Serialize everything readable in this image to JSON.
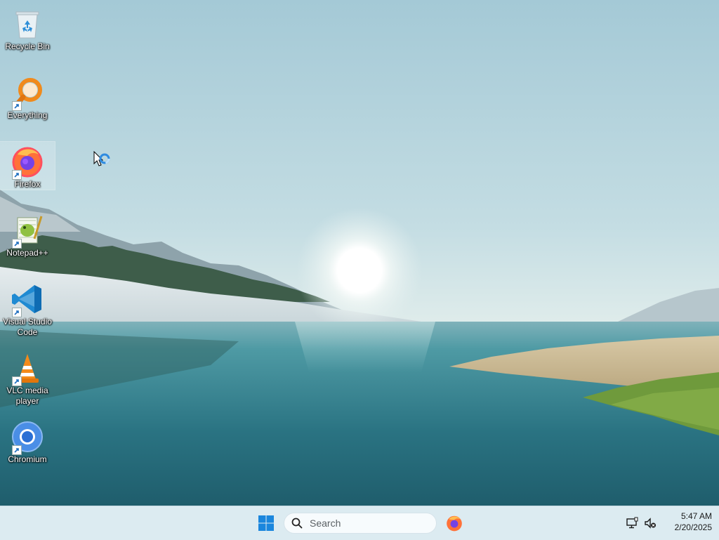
{
  "desktop": {
    "icons": [
      {
        "label": "Recycle Bin"
      },
      {
        "label": "Everything"
      },
      {
        "label": "Firefox"
      },
      {
        "label": "Notepad++"
      },
      {
        "label": "Visual Studio Code"
      },
      {
        "label": "VLC media player"
      },
      {
        "label": "Chromium"
      }
    ]
  },
  "taskbar": {
    "search_placeholder": "Search",
    "pinned_apps": [
      "firefox-icon"
    ],
    "tray": [
      "network-icon",
      "volume-muted-icon"
    ],
    "clock": {
      "time": "5:47 AM",
      "date": "2/20/2025"
    }
  },
  "colors": {
    "taskbar_bg": "#dcebf1",
    "sky_top": "#a9cdd8",
    "water": "#2f7f8e"
  }
}
